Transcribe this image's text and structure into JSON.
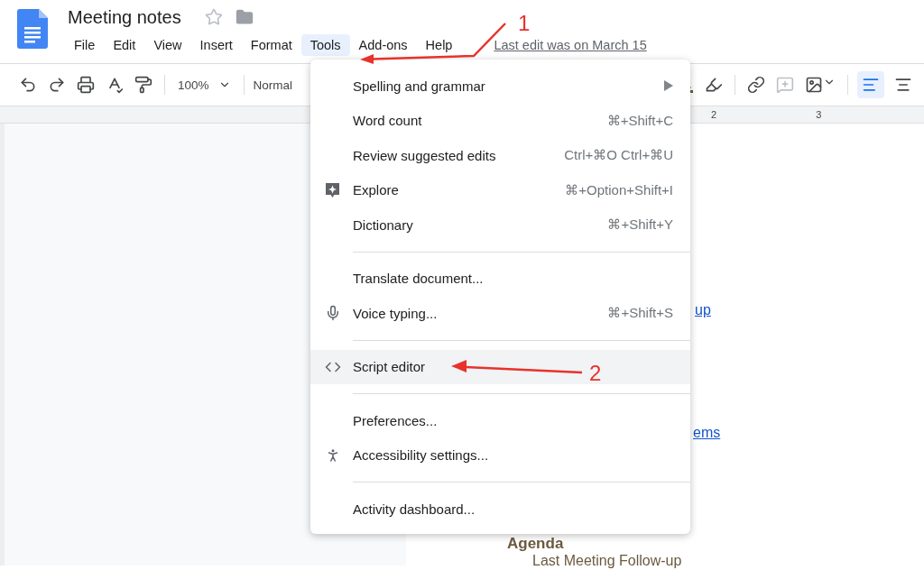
{
  "document": {
    "title": "Meeting notes",
    "last_edit": "Last edit was on March 15"
  },
  "menu_bar": [
    {
      "label": "File",
      "selected": false
    },
    {
      "label": "Edit",
      "selected": false
    },
    {
      "label": "View",
      "selected": false
    },
    {
      "label": "Insert",
      "selected": false
    },
    {
      "label": "Format",
      "selected": false
    },
    {
      "label": "Tools",
      "selected": true
    },
    {
      "label": "Add-ons",
      "selected": false
    },
    {
      "label": "Help",
      "selected": false
    }
  ],
  "toolbar": {
    "zoom": "100%",
    "style": "Normal",
    "align_buttons": [
      {
        "kind": "left",
        "selected": true
      },
      {
        "kind": "center",
        "selected": false
      }
    ]
  },
  "ruler": [
    "2",
    "3"
  ],
  "tools_menu": {
    "sections": [
      [
        {
          "label": "Spelling and grammar",
          "kind": "submenu",
          "highlighted": false
        },
        {
          "label": "Word count",
          "shortcut": "⌘+Shift+C",
          "kind": "plain",
          "highlighted": false
        },
        {
          "label": "Review suggested edits",
          "shortcut": "Ctrl+⌘O Ctrl+⌘U",
          "kind": "plain",
          "highlighted": false
        },
        {
          "label": "Explore",
          "shortcut": "⌘+Option+Shift+I",
          "kind": "explore",
          "highlighted": false
        },
        {
          "label": "Dictionary",
          "shortcut": "⌘+Shift+Y",
          "kind": "plain",
          "highlighted": false
        }
      ],
      [
        {
          "label": "Translate document...",
          "kind": "plain",
          "highlighted": false
        },
        {
          "label": "Voice typing...",
          "shortcut": "⌘+Shift+S",
          "kind": "voice",
          "highlighted": false
        }
      ],
      [
        {
          "label": "Script editor",
          "kind": "code",
          "highlighted": true
        }
      ],
      [
        {
          "label": "Preferences...",
          "kind": "plain",
          "highlighted": false
        },
        {
          "label": "Accessibility settings...",
          "kind": "accessibility",
          "highlighted": false
        }
      ],
      [
        {
          "label": "Activity dashboard...",
          "kind": "plain",
          "highlighted": false
        }
      ]
    ]
  },
  "page": {
    "lines": [
      {
        "text": "up",
        "kind": "link"
      },
      {
        "text": "ems",
        "kind": "link"
      },
      {
        "text": "Agenda",
        "kind": "heading"
      },
      {
        "text": "Last Meeting Follow-up",
        "kind": "body"
      }
    ]
  },
  "annotations": [
    {
      "label": "1"
    },
    {
      "label": "2"
    }
  ]
}
